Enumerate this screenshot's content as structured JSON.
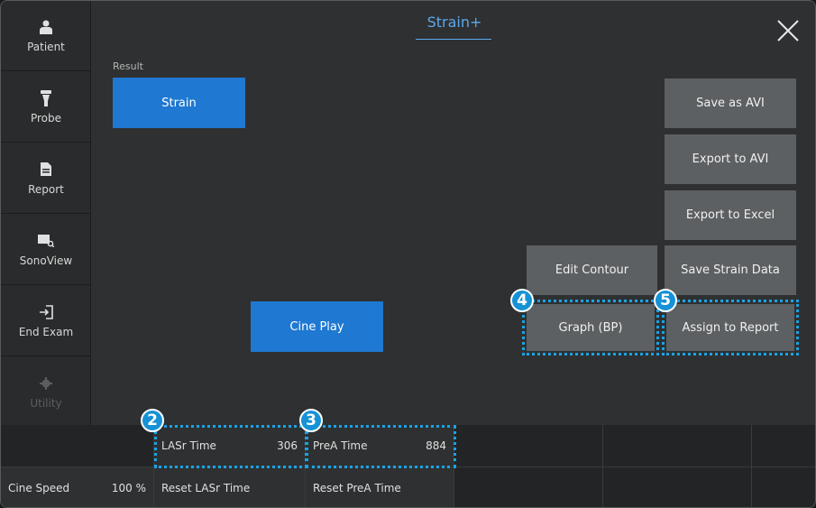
{
  "sidebar": {
    "items": [
      {
        "label": "Patient",
        "icon": "person-icon",
        "enabled": true
      },
      {
        "label": "Probe",
        "icon": "probe-icon",
        "enabled": true
      },
      {
        "label": "Report",
        "icon": "document-icon",
        "enabled": true
      },
      {
        "label": "SonoView",
        "icon": "sonoview-icon",
        "enabled": true
      },
      {
        "label": "End Exam",
        "icon": "exit-icon",
        "enabled": true
      },
      {
        "label": "Utility",
        "icon": "gear-icon",
        "enabled": false
      }
    ]
  },
  "header": {
    "title": "Strain+"
  },
  "result": {
    "label": "Result",
    "strain_button": "Strain"
  },
  "cine_play": "Cine Play",
  "actions": {
    "save_avi": "Save as AVI",
    "export_avi": "Export to AVI",
    "export_excel": "Export to Excel",
    "edit_contour": "Edit Contour",
    "save_strain": "Save Strain Data",
    "graph_bp": "Graph (BP)",
    "assign_report": "Assign to Report"
  },
  "badges": {
    "b2": "2",
    "b3": "3",
    "b4": "4",
    "b5": "5"
  },
  "bottom": {
    "lasr_label": "LASr Time",
    "lasr_value": "306",
    "prea_label": "PreA Time",
    "prea_value": "884",
    "cine_speed_label": "Cine Speed",
    "cine_speed_value": "100 %",
    "reset_lasr": "Reset LASr Time",
    "reset_prea": "Reset PreA Time"
  },
  "colors": {
    "accent": "#1f78d1",
    "highlight": "#19a3e6",
    "title": "#5aa9ee"
  }
}
